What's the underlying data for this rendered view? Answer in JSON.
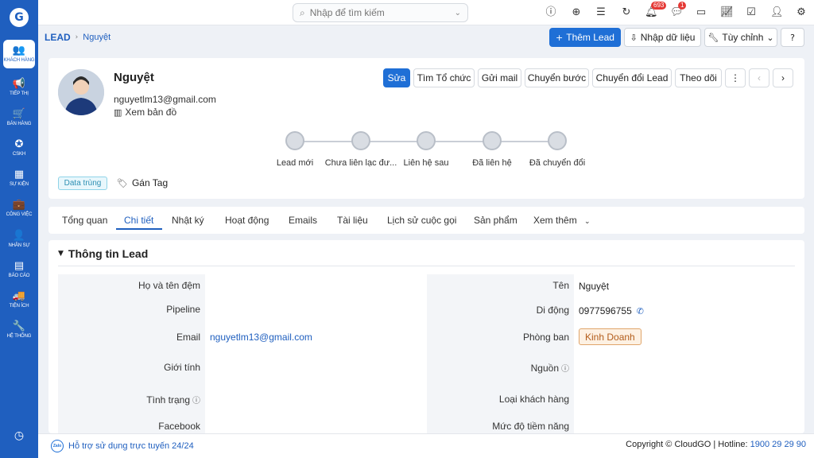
{
  "sidebar": {
    "logo": "G",
    "items": [
      {
        "icon": "👥",
        "label": "KHÁCH HÀNG"
      },
      {
        "icon": "📢",
        "label": "TIẾP THỊ"
      },
      {
        "icon": "🛒",
        "label": "BÁN HÀNG"
      },
      {
        "icon": "✪",
        "label": "CSKH"
      },
      {
        "icon": "▦",
        "label": "SỰ KIỆN"
      },
      {
        "icon": "💼",
        "label": "CÔNG VIỆC"
      },
      {
        "icon": "👤",
        "label": "NHÂN SỰ"
      },
      {
        "icon": "▤",
        "label": "BÁO CÁO"
      },
      {
        "icon": "🚚",
        "label": "TIỆN ÍCH"
      },
      {
        "icon": "🔧",
        "label": "HỆ THỐNG"
      }
    ],
    "bottom_icon": "◷"
  },
  "topbar": {
    "search_placeholder": "Nhập để tìm kiếm",
    "notifications_count": "693",
    "messages_count": "1"
  },
  "breadcrumb": {
    "root": "LEAD",
    "current": "Nguyệt"
  },
  "header_actions": {
    "add_lead": "Thêm Lead",
    "import": "Nhập dữ liệu",
    "customize": "Tùy chỉnh"
  },
  "profile": {
    "name": "Nguyệt",
    "email": "nguyetlm13@gmail.com",
    "map_link": "Xem bản đồ",
    "duplicate_tag": "Data trùng",
    "assign_tag": "Gán Tag"
  },
  "actions": {
    "edit": "Sửa",
    "find_org": "Tìm Tổ chức",
    "send_mail": "Gửi mail",
    "move_step": "Chuyển bước",
    "convert_lead": "Chuyển đổi Lead",
    "follow": "Theo dõi"
  },
  "steps": [
    "Lead mới",
    "Chưa liên lạc đư...",
    "Liên hệ sau",
    "Đã liên hệ",
    "Đã chuyển đổi"
  ],
  "tabs": [
    "Tổng quan",
    "Chi tiết",
    "Nhật ký",
    "Hoạt động",
    "Emails",
    "Tài liệu",
    "Lịch sử cuộc gọi",
    "Sản phẩm",
    "Xem thêm"
  ],
  "section": {
    "title": "Thông tin Lead",
    "left": [
      {
        "label": "Họ và tên đệm",
        "value": ""
      },
      {
        "label": "Pipeline",
        "value": ""
      },
      {
        "label": "Email",
        "value": "nguyetlm13@gmail.com"
      },
      {
        "label": "Giới tính",
        "value": ""
      },
      {
        "label": "Tình trạng",
        "value": ""
      },
      {
        "label": "Facebook",
        "value": ""
      }
    ],
    "right": [
      {
        "label": "Tên",
        "value": "Nguyệt"
      },
      {
        "label": "Di động",
        "value": "0977596755"
      },
      {
        "label": "Phòng ban",
        "value": "Kinh Doanh"
      },
      {
        "label": "Nguồn",
        "value": ""
      },
      {
        "label": "Loại khách hàng",
        "value": ""
      },
      {
        "label": "Mức độ tiềm năng",
        "value": ""
      }
    ]
  },
  "footer": {
    "zalo": "Zalo",
    "support": "Hỗ trợ sử dụng trực tuyến 24/24",
    "copyright": "Copyright © CloudGO | Hotline: ",
    "hotline": "1900 29 29 90"
  }
}
